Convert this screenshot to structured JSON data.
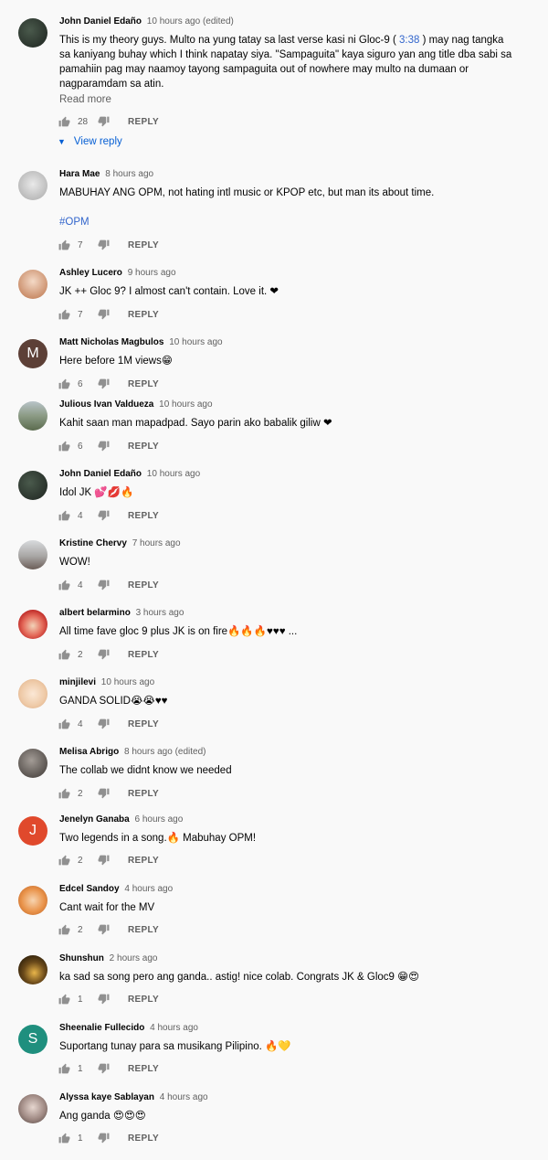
{
  "labels": {
    "reply": "REPLY",
    "read_more": "Read more",
    "view_reply": "View reply"
  },
  "comments": [
    {
      "author": "John Daniel Edaño",
      "time": "10 hours ago (edited)",
      "text_a": "This is my theory guys. Multo na yung tatay sa last verse kasi ni Gloc-9 ( ",
      "timestamp": "3:38",
      "text_b": " ) may nag tangka sa kaniyang buhay which I think napatay siya.  \"Sampaguita\" kaya siguro yan ang title dba sabi sa pamahiin pag may naamoy tayong sampaguita out of nowhere may multo na dumaan or nagparamdam sa atin.",
      "likes": "28",
      "avatar_color": "#2f3b33"
    },
    {
      "author": "Hara Mae",
      "time": "8 hours ago",
      "text": "MABUHAY ANG OPM, not hating intl music or KPOP etc, but man its about time.",
      "hashtag": "#OPM",
      "likes": "7",
      "avatar_color": "#c9c9c9"
    },
    {
      "author": "Ashley Lucero",
      "time": "9 hours ago",
      "text": "JK ++ Gloc 9? I almost can't contain. Love it. ❤",
      "likes": "7",
      "avatar_color": "#d9a98a"
    },
    {
      "author": "Matt Nicholas Magbulos",
      "time": "10 hours ago",
      "text": "Here before 1M views😁",
      "likes": "6",
      "avatar_color": "#5d4037",
      "avatar_letter": "M"
    },
    {
      "author": "Julious Ivan Valdueza",
      "time": "10 hours ago",
      "text": "Kahit saan man mapadpad. Sayo parin ako babalik giliw ❤",
      "likes": "6",
      "avatar_color": "#7c8c7a"
    },
    {
      "author": "John Daniel Edaño",
      "time": "10 hours ago",
      "text": "Idol JK 💕💋🔥",
      "likes": "4",
      "avatar_color": "#2f3b33"
    },
    {
      "author": "Kristine Chervy",
      "time": "7 hours ago",
      "text": "WOW!",
      "likes": "4",
      "avatar_color": "#b7b9bd"
    },
    {
      "author": "albert belarmino",
      "time": "3 hours ago",
      "text": "All time fave gloc 9 plus JK is on fire🔥🔥🔥♥♥♥ ...",
      "likes": "2",
      "avatar_color": "#c62828"
    },
    {
      "author": "minjilevi",
      "time": "10 hours ago",
      "text": "GANDA SOLID😭😭♥♥",
      "likes": "4",
      "avatar_color": "#f3dcc4"
    },
    {
      "author": "Melisa Abrigo",
      "time": "8 hours ago (edited)",
      "text": "The collab we didnt know we needed",
      "likes": "2",
      "avatar_color": "#6f6a66"
    },
    {
      "author": "Jenelyn Ganaba",
      "time": "6 hours ago",
      "text": "Two legends in a song.🔥 Mabuhay OPM!",
      "likes": "2",
      "avatar_color": "#e0492c",
      "avatar_letter": "J"
    },
    {
      "author": "Edcel Sandoy",
      "time": "4 hours ago",
      "text": "Cant wait for the MV",
      "likes": "2",
      "avatar_color": "#e8a15a"
    },
    {
      "author": "Shunshun",
      "time": "2 hours ago",
      "text": "ka sad sa song pero ang ganda.. astig! nice colab. Congrats JK & Gloc9 😁😍",
      "likes": "1",
      "avatar_color": "#3a2a12"
    },
    {
      "author": "Sheenalie Fullecido",
      "time": "4 hours ago",
      "text": "Suportang tunay para sa musikang Pilipino. 🔥💛",
      "likes": "1",
      "avatar_color": "#1f8f7e",
      "avatar_letter": "S"
    },
    {
      "author": "Alyssa kaye Sablayan",
      "time": "4 hours ago",
      "text": "Ang ganda 😍😍😍",
      "likes": "1",
      "avatar_color": "#9c8a86"
    }
  ]
}
